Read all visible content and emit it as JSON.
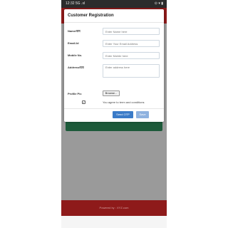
{
  "statusbar": {
    "time": "12:32",
    "signal": "5G .ııl",
    "battery_icons": "⊙ ▾ ▮"
  },
  "modal": {
    "title": "Customer Registration",
    "fields": [
      {
        "label": "Name/नाम",
        "placeholder": "Enter Name here"
      },
      {
        "label": "Email-Id",
        "placeholder": "Enter Your Email Address"
      },
      {
        "label": "Mobile No.",
        "placeholder": "Enter Mobile here"
      },
      {
        "label": "Address/पता",
        "placeholder": "Enter address here"
      }
    ],
    "profile_pic_label": "Profile Pic",
    "browse_label": "Browse...",
    "agree_check": "✓",
    "agree_text": "You agree to term and conditions",
    "send_otp_label": "Send OTP",
    "save_label": "Save"
  },
  "footer": {
    "text": "Powered by : XYZ.com"
  }
}
